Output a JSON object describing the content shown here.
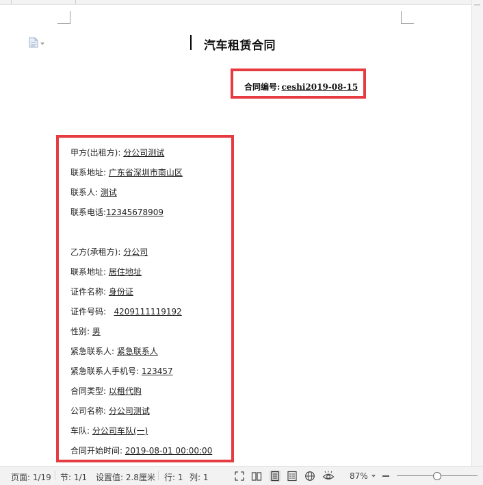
{
  "document": {
    "title": "汽车租赁合同",
    "contract_no_label": "合同编号:",
    "contract_no_value": "ceshi2019-08-15",
    "fields": [
      {
        "label": "甲方(出租方):",
        "value": "分公司测试"
      },
      {
        "label": "联系地址:",
        "value": "广东省深圳市南山区"
      },
      {
        "label": "联系人:",
        "value": "测试"
      },
      {
        "label": "联系电话:",
        "value": "12345678909"
      },
      {
        "label": "乙方(承租方):",
        "value": "分公司"
      },
      {
        "label": "联系地址:",
        "value": "居住地址"
      },
      {
        "label": "证件名称:",
        "value": "身份证"
      },
      {
        "label": "证件号码:",
        "value": "4209111119192"
      },
      {
        "label": "性别:",
        "value": "男"
      },
      {
        "label": "紧急联系人:",
        "value": "紧急联系人"
      },
      {
        "label": "紧急联系人手机号:",
        "value": "123457"
      },
      {
        "label": "合同类型:",
        "value": "以租代购"
      },
      {
        "label": "公司名称:",
        "value": "分公司测试"
      },
      {
        "label": "车队:",
        "value": "分公司车队(一)"
      },
      {
        "label": "合同开始时间:",
        "value": "2019-08-01 00:00:00"
      }
    ]
  },
  "statusbar": {
    "page": "页面: 1/19",
    "section": "节: 1/1",
    "setting": "设置值: 2.8厘米",
    "row": "行: 1",
    "col": "列: 1",
    "zoom": "87%"
  },
  "icons": {
    "doc": "document-icon",
    "fullscreen": "fullscreen-icon",
    "read_mode": "read-mode-icon",
    "page_view": "page-view-icon",
    "outline": "outline-icon",
    "web": "web-layout-icon",
    "eye": "eye-protection-icon"
  },
  "colors": {
    "highlight_box": "#e53b41",
    "statusbar_bg": "#f2f2f2"
  }
}
